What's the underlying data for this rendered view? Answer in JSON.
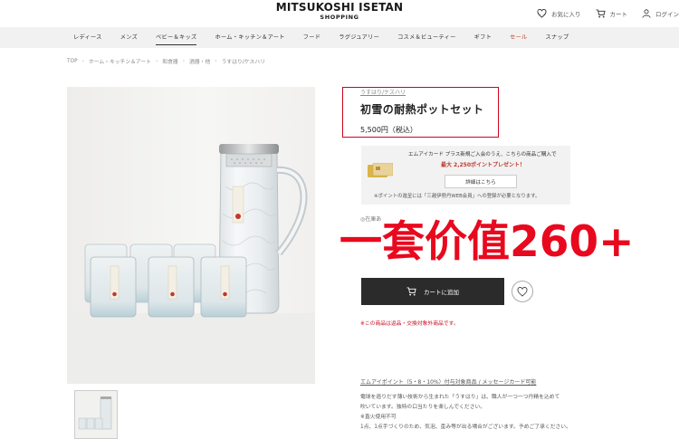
{
  "header": {
    "logo_main": "MITSUKOSHI ISETAN",
    "logo_sub": "SHOPPING",
    "favorites_label": "お気に入り",
    "cart_label": "カート",
    "login_label": "ログイン"
  },
  "nav": {
    "items": [
      {
        "label": "レディース"
      },
      {
        "label": "メンズ"
      },
      {
        "label": "ベビー＆キッズ"
      },
      {
        "label": "ホーム・キッチン＆アート"
      },
      {
        "label": "フード"
      },
      {
        "label": "ラグジュアリー"
      },
      {
        "label": "コスメ＆ビューティー"
      },
      {
        "label": "ギフト"
      },
      {
        "label": "セール"
      },
      {
        "label": "スナップ"
      }
    ]
  },
  "breadcrumb": [
    {
      "label": "TOP"
    },
    {
      "label": "ホーム・キッチン＆アート"
    },
    {
      "label": "和食器"
    },
    {
      "label": "酒器・他"
    },
    {
      "label": "うすはり/ケスハリ"
    }
  ],
  "product": {
    "brand": "うすはり/ケスハリ",
    "title": "初雪の耐熱ポットセット",
    "price": "5,500円（税込）",
    "favorite_count": "◎在庫あ"
  },
  "card_promo": {
    "line1": "エムアイカード プラス新規ご入会のうえ、こちらの商品ご購入で",
    "line2_prefix": "最大 2,250ポイントプレゼント！",
    "details_button": "詳細はこちら",
    "note": "※ポイントの進呈には「三越伊勢丹WEB会員」への登録が必要となります。"
  },
  "overlay_text": "一套价值260+",
  "actions": {
    "add_to_cart": "カートに追加"
  },
  "return_note": "※この商品は返品・交換対象外商品です。",
  "points_line": "エムアイポイント（5・8・10%）付与対象商品 / メッセージカード可能",
  "description": [
    "電球を造りだす薄い技術から生まれた「うすはり」は、職人が一つ一つ丹精を込めて",
    "吹いています。独特の口当たりを楽しんでください。",
    "※直火使用不可",
    "1点、1点手づくりのため、気泡、歪み等が出る場合がございます。予めご了承ください。"
  ],
  "colors": {
    "accent_red": "#d0021b",
    "button_dark": "#2b2b2b",
    "nav_bg": "#f1f1f1"
  }
}
